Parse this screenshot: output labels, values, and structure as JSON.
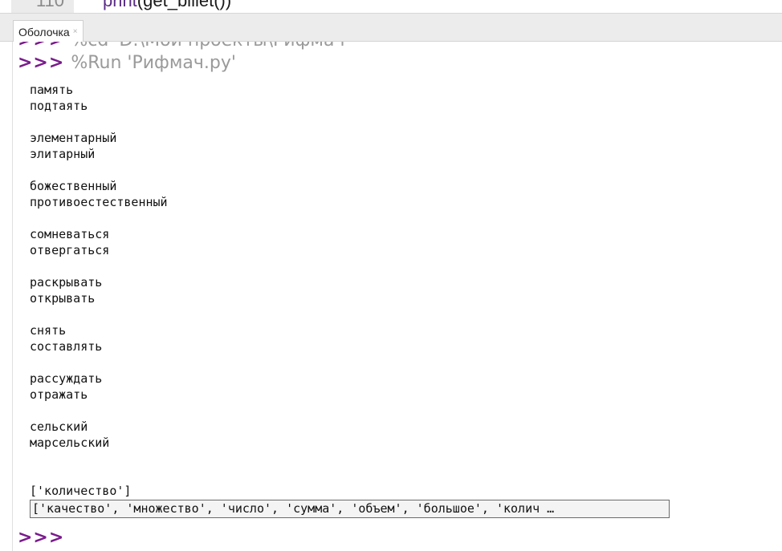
{
  "editor": {
    "line_number": "110",
    "code_call": "print",
    "code_rest": "(get_billet())"
  },
  "tabs": [
    {
      "label": "Оболочка",
      "close": "×"
    }
  ],
  "shell": {
    "prompt": ">>>",
    "cd_command": "%cd 'D:\\Мои проекты\\Рифмач'",
    "run_command": "%Run 'Рифмач.py'",
    "output_lines": [
      "память",
      "подтаять",
      "",
      "элементарный",
      "элитарный",
      "",
      "божественный",
      "противоестественный",
      "",
      "сомневаться",
      "отвергаться",
      "",
      "раскрывать",
      "открывать",
      "",
      "снять",
      "составлять",
      "",
      "рассуждать",
      "отражать",
      "",
      "сельский",
      "марсельский",
      "",
      "",
      "['количество']"
    ],
    "list_output": "['качество', 'множество', 'число', 'сумма', 'объем', 'большое', 'колич …"
  }
}
